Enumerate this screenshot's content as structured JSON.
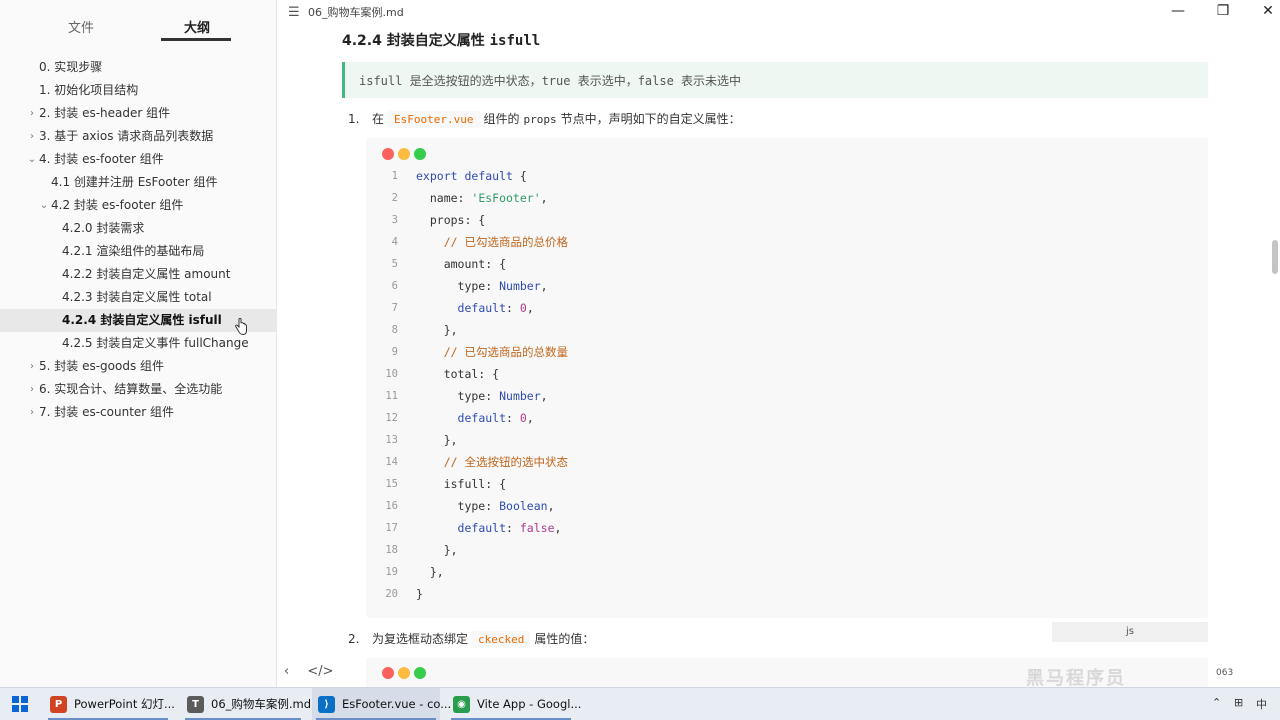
{
  "sidebar": {
    "tabs": {
      "files": "文件",
      "outline": "大纲"
    },
    "items": [
      {
        "label": "0. 实现步骤",
        "level": 1,
        "chev": ""
      },
      {
        "label": "1. 初始化项目结构",
        "level": 1,
        "chev": ""
      },
      {
        "label": "2. 封装 es-header 组件",
        "level": 1,
        "chev": "›"
      },
      {
        "label": "3. 基于 axios 请求商品列表数据",
        "level": 1,
        "chev": "›"
      },
      {
        "label": "4. 封装 es-footer 组件",
        "level": 1,
        "chev": "⌄"
      },
      {
        "label": "4.1 创建并注册 EsFooter 组件",
        "level": 2,
        "chev": ""
      },
      {
        "label": "4.2 封装 es-footer 组件",
        "level": 2,
        "chev": "⌄"
      },
      {
        "label": "4.2.0 封装需求",
        "level": 3,
        "chev": ""
      },
      {
        "label": "4.2.1 渲染组件的基础布局",
        "level": 3,
        "chev": ""
      },
      {
        "label": "4.2.2 封装自定义属性 amount",
        "level": 3,
        "chev": ""
      },
      {
        "label": "4.2.3 封装自定义属性 total",
        "level": 3,
        "chev": ""
      },
      {
        "label": "4.2.4 封装自定义属性 isfull",
        "level": 3,
        "chev": "",
        "active": true
      },
      {
        "label": "4.2.5 封装自定义事件 fullChange",
        "level": 3,
        "chev": ""
      },
      {
        "label": "5. 封装 es-goods 组件",
        "level": 1,
        "chev": "›"
      },
      {
        "label": "6. 实现合计、结算数量、全选功能",
        "level": 1,
        "chev": "›"
      },
      {
        "label": "7. 封装 es-counter 组件",
        "level": 1,
        "chev": "›"
      }
    ]
  },
  "titlebar": {
    "menu_glyph": "☰",
    "file_name": "06_购物车案例.md",
    "min": "—",
    "max": "❐",
    "close": "✕"
  },
  "content": {
    "heading_num": "4.2.4 封装自定义属性",
    "heading_code": "isfull",
    "quote": "isfull 是全选按钮的选中状态，true 表示选中，false 表示未选中",
    "step1": {
      "num": "1.",
      "pre": "在",
      "code": "EsFooter.vue",
      "mid": "组件的",
      "mono": "props",
      "post": "节点中，声明如下的自定义属性："
    },
    "code_lines": [
      "export default {",
      "  name: 'EsFooter',",
      "  props: {",
      "    // 已勾选商品的总价格",
      "    amount: {",
      "      type: Number,",
      "      default: 0,",
      "    },",
      "    // 已勾选商品的总数量",
      "    total: {",
      "      type: Number,",
      "      default: 0,",
      "    },",
      "    // 全选按钮的选中状态",
      "    isfull: {",
      "      type: Boolean,",
      "      default: false,",
      "    },",
      "  },",
      "}"
    ],
    "lang": "js",
    "step2": {
      "num": "2.",
      "pre": "为复选框动态绑定",
      "code": "ckecked",
      "post": "属性的值："
    },
    "footer_icons": {
      "back": "‹",
      "source": "</>"
    },
    "word_count": "063",
    "watermark": "黑马程序员"
  },
  "colors": {
    "keyword": "#2f4cb3",
    "string": "#2e9c6b",
    "comment": "#c0661c",
    "number": "#b03a8e",
    "property": "#333333",
    "accent": "#42b983"
  },
  "taskbar": {
    "items": [
      {
        "label": "PowerPoint 幻灯...",
        "icon": "P",
        "color": "#d04423"
      },
      {
        "label": "06_购物车案例.md...",
        "icon": "T",
        "color": "#5b5b5b"
      },
      {
        "label": "EsFooter.vue - co...",
        "icon": "⟩",
        "color": "#0a6fc6"
      },
      {
        "label": "Vite App - Googl...",
        "icon": "◉",
        "color": "#2a9c4e"
      }
    ],
    "tray": {
      "chevron": "⌃",
      "net": "⊞",
      "ime": "中"
    }
  }
}
